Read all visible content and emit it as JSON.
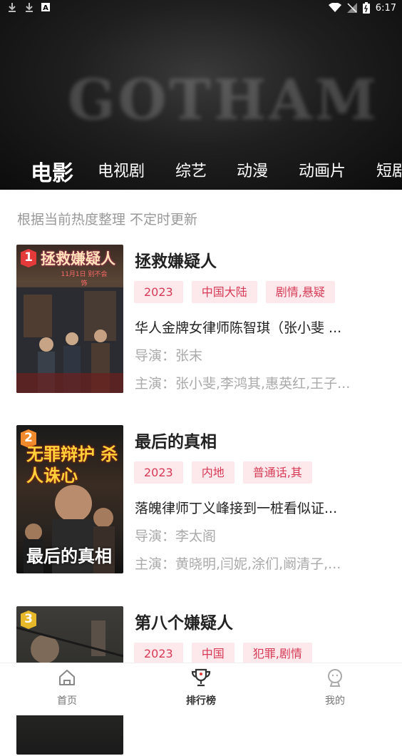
{
  "status_bar": {
    "time": "6:17",
    "left_icons": [
      "download-icon",
      "download-icon",
      "font-icon"
    ],
    "right_icons": [
      "wifi-icon",
      "signal-icon",
      "battery-icon"
    ]
  },
  "hero": {
    "watermark": "GOTHAM"
  },
  "categories": [
    "电影",
    "电视剧",
    "综艺",
    "动漫",
    "动画片",
    "短剧"
  ],
  "active_category": "电影",
  "hint": "根据当前热度整理 不定时更新",
  "colors": {
    "accent": "#d63a55",
    "tag_bg": "#fde8ec"
  },
  "items": [
    {
      "rank": "1",
      "poster_text": "拯救嫌疑人",
      "poster_badge": "11月1日 别不会饰",
      "title": "拯救嫌疑人",
      "tags": [
        "2023",
        "中国大陆",
        "剧情,悬疑"
      ],
      "description": "华人金牌女律师陈智琪（张小斐 ...",
      "director": "导演：张末",
      "cast": "主演：张小斐,李鸿其,惠英红,王子..."
    },
    {
      "rank": "2",
      "poster_text": "无罪辩护 杀人诛心",
      "poster_badge": "最后的真相",
      "title": "最后的真相",
      "tags": [
        "2023",
        "内地",
        "普通话,其"
      ],
      "description": "落魄律师丁义峰接到一桩看似证...",
      "director": "导演：李太阁",
      "cast": "主演：黄晓明,闫妮,涂们,阚清子,..."
    },
    {
      "rank": "3",
      "poster_text": "",
      "poster_badge": "",
      "title": "第八个嫌疑人",
      "tags": [
        "2023",
        "中国",
        "犯罪,剧情"
      ],
      "description": "",
      "director": "",
      "cast": ""
    }
  ],
  "bottom_nav": [
    {
      "label": "首页",
      "icon": "home-icon"
    },
    {
      "label": "排行榜",
      "icon": "trophy-icon"
    },
    {
      "label": "我的",
      "icon": "user-icon"
    }
  ],
  "active_nav": "排行榜"
}
